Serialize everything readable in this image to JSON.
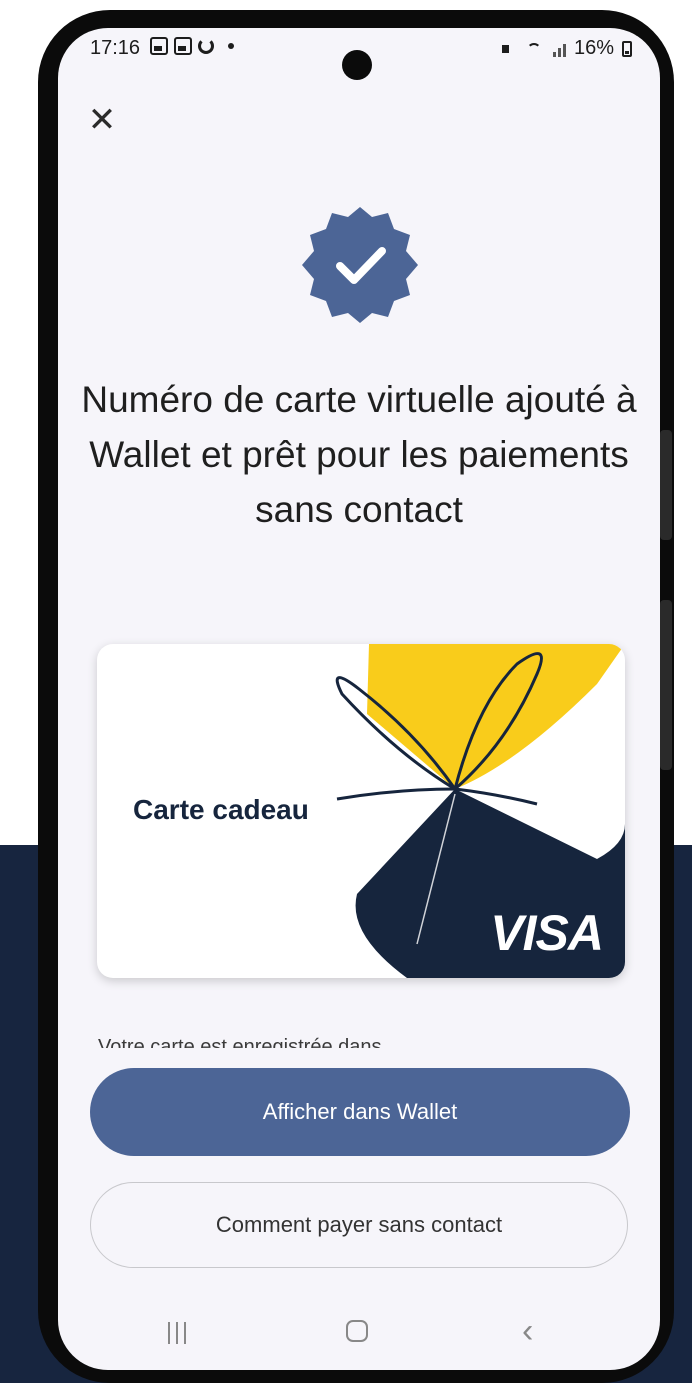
{
  "status_bar": {
    "time": "17:16",
    "battery": "16%"
  },
  "header": {
    "close_icon": "close-icon"
  },
  "success_badge": {
    "icon": "check-badge-icon",
    "color": "#4c6596"
  },
  "title": "Numéro de carte virtuelle ajouté à Wallet et prêt pour les paiements sans contact",
  "card": {
    "label": "Carte cadeau",
    "network": "VISA",
    "colors": {
      "navy": "#16253d",
      "yellow": "#f9cc1b"
    }
  },
  "info_text": "Votre carte est enregistrée dans",
  "buttons": {
    "primary": "Afficher dans Wallet",
    "secondary": "Comment payer sans contact"
  },
  "nav": {
    "recents_icon": "recents-icon",
    "home_icon": "home-icon",
    "back_icon": "back-icon"
  },
  "colors": {
    "accent": "#4c6596",
    "background_navy": "#17253f"
  }
}
